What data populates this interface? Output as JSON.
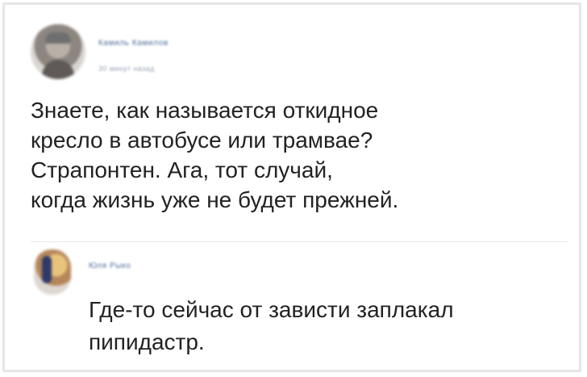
{
  "post": {
    "author_name": "Камиль Камилов",
    "post_meta": "30 минут назад",
    "text": "Знаете, как называется откидное\nкресло в автобусе или трамвае?\nСтрапонтен. Ага, тот случай,\nкогда жизнь уже не будет прежней."
  },
  "reply": {
    "author_name": "Юля Рыко",
    "text": "Где-то сейчас от зависти заплакал\nпипидастр."
  },
  "colors": {
    "frame_border": "#e6e6e6",
    "text": "#222222",
    "link_name": "#4e6f9a",
    "meta": "#9aa6b4",
    "divider": "#e7e8ec"
  }
}
